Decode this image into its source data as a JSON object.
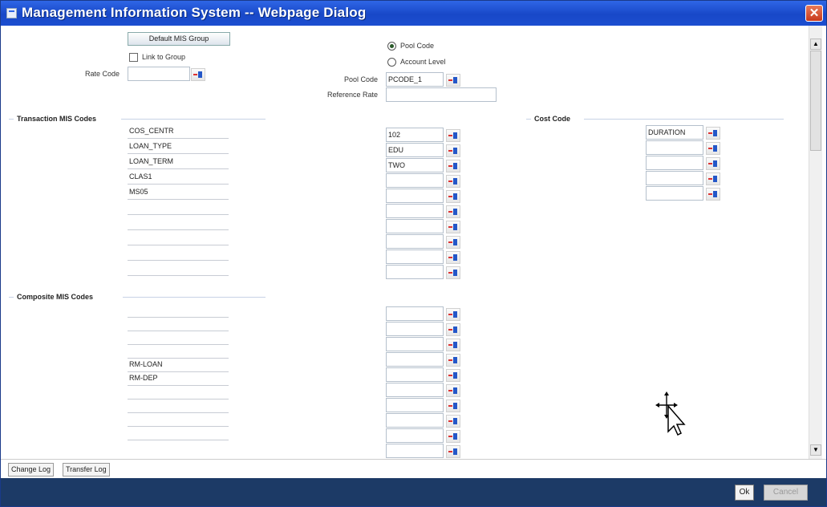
{
  "window": {
    "title": "Management Information System -- Webpage Dialog",
    "close_label": "✕"
  },
  "top": {
    "default_mis_group_label": "Default MIS Group",
    "link_to_group_label": "Link to Group",
    "link_to_group_checked": false,
    "rate_code_label": "Rate Code",
    "rate_code_value": "",
    "pool_code_radio_label": "Pool Code",
    "account_level_radio_label": "Account Level",
    "selected_radio": "Pool Code",
    "pool_code_label": "Pool Code",
    "pool_code_value": "PCODE_1",
    "reference_rate_label": "Reference Rate",
    "reference_rate_value": ""
  },
  "transaction_mis": {
    "title": "Transaction MIS Codes",
    "classes": [
      "COS_CENTR",
      "LOAN_TYPE",
      "LOAN_TERM",
      "CLAS1",
      "MS05",
      "",
      "",
      "",
      "",
      ""
    ],
    "values": [
      "102",
      "EDU",
      "TWO",
      "",
      "",
      "",
      "",
      "",
      "",
      ""
    ]
  },
  "cost_code": {
    "title": "Cost Code",
    "values": [
      "DURATION",
      "",
      "",
      "",
      ""
    ]
  },
  "composite_mis": {
    "title": "Composite MIS Codes",
    "classes": [
      "",
      "",
      "",
      "",
      "RM-LOAN",
      "RM-DEP",
      "",
      "",
      "",
      ""
    ],
    "values": [
      "",
      "",
      "",
      "",
      "",
      "",
      "",
      "",
      "",
      ""
    ]
  },
  "tabs": [
    "Change Log",
    "Transfer Log"
  ],
  "footer": {
    "ok_label": "Ok",
    "cancel_label": "Cancel"
  },
  "scrollbar": {
    "up_arrow": "▲",
    "down_arrow": "▼"
  }
}
